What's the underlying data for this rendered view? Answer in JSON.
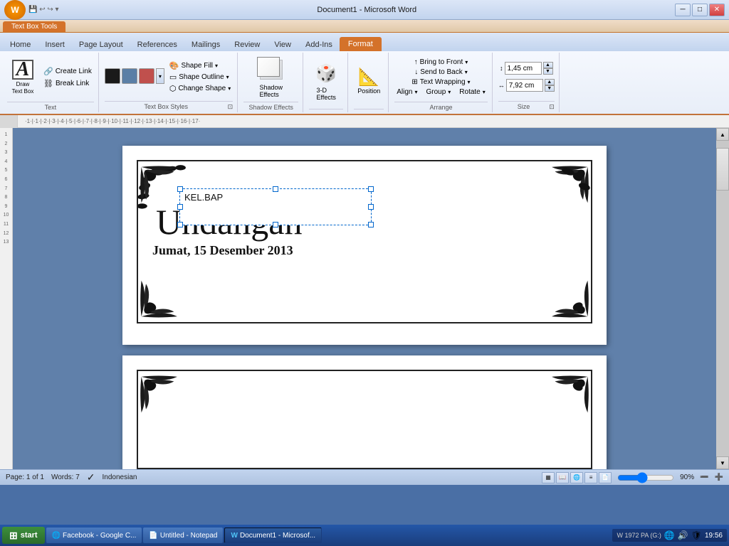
{
  "titleBar": {
    "title": "Document1 - Microsoft Word",
    "contextTitle": "Text Box Tools",
    "minBtn": "─",
    "maxBtn": "□",
    "closeBtn": "✕"
  },
  "quickAccess": {
    "save": "💾",
    "undo": "↩",
    "redo": "↪"
  },
  "tabs": [
    {
      "label": "Home",
      "active": false
    },
    {
      "label": "Insert",
      "active": false
    },
    {
      "label": "Page Layout",
      "active": false
    },
    {
      "label": "References",
      "active": false
    },
    {
      "label": "Mailings",
      "active": false
    },
    {
      "label": "Review",
      "active": false
    },
    {
      "label": "View",
      "active": false
    },
    {
      "label": "Add-Ins",
      "active": false
    },
    {
      "label": "Format",
      "active": true
    }
  ],
  "ribbon": {
    "textGroup": {
      "label": "Text",
      "drawLabel": "Draw\nText Box",
      "createLink": "Create Link",
      "breakLink": "Break Link"
    },
    "textBoxStyles": {
      "label": "Text Box Styles",
      "colors": [
        "#1a1a1a",
        "#5b7fa6",
        "#c0504d"
      ],
      "shapeFill": "Shape Fill",
      "shapeOutline": "Shape Outline",
      "changeShape": "Change Shape"
    },
    "shadowEffects": {
      "label": "Shadow Effects",
      "shadowBtn": "Shadow\nEffects"
    },
    "effects3D": {
      "label": "",
      "btn3D": "3-D\nEffects"
    },
    "position": {
      "label": "",
      "posBtn": "Position"
    },
    "arrange": {
      "label": "Arrange",
      "bringFront": "Bring to Front",
      "sendBack": "Send to Back",
      "textWrapping": "Text Wrapping",
      "align": "Align",
      "group": "Group",
      "rotate": "Rotate"
    },
    "size": {
      "label": "Size",
      "height": "1,45 cm",
      "width": "7,92 cm"
    }
  },
  "document": {
    "page1": {
      "textBoxContent": "KEL.BAP",
      "undanganText": "Undangan",
      "dateText": "Jumat, 15 Desember 2013"
    }
  },
  "statusBar": {
    "page": "Page: 1 of 1",
    "words": "Words: 7",
    "language": "Indonesian",
    "zoom": "90%"
  },
  "taskbar": {
    "start": "start",
    "items": [
      {
        "label": "Facebook - Google C...",
        "icon": "🌐"
      },
      {
        "label": "Untitled - Notepad",
        "icon": "📄"
      },
      {
        "label": "Document1 - Microsof...",
        "icon": "W",
        "active": true
      }
    ],
    "tray": {
      "w1972": "W 1972 PA (G:)",
      "time": "19:56",
      "icons": [
        "🔊",
        "🌐",
        "🛡"
      ]
    }
  }
}
